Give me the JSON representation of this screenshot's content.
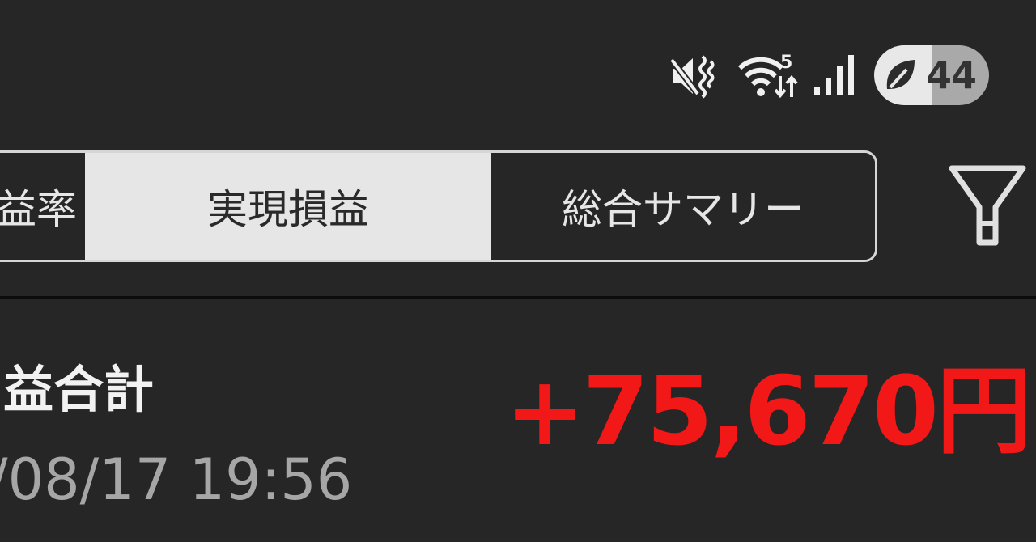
{
  "status_bar": {
    "icons": [
      "mute-vibrate-icon",
      "wifi-icon",
      "signal-icon",
      "battery-saver-leaf-icon"
    ],
    "wifi_label": "5",
    "battery_level": "44"
  },
  "tabs": [
    {
      "label": "益率",
      "selected": false
    },
    {
      "label": "実現損益",
      "selected": true
    },
    {
      "label": "総合サマリー",
      "selected": false
    }
  ],
  "filter": {
    "icon": "filter-icon"
  },
  "summary": {
    "title": "益合計",
    "datetime": "/08/17  19:56",
    "amount": "+75,670円"
  },
  "colors": {
    "background": "#262626",
    "tab_selected_bg": "#e6e6e6",
    "positive_amount": "#f21818",
    "secondary_text": "#a6a6a6"
  }
}
